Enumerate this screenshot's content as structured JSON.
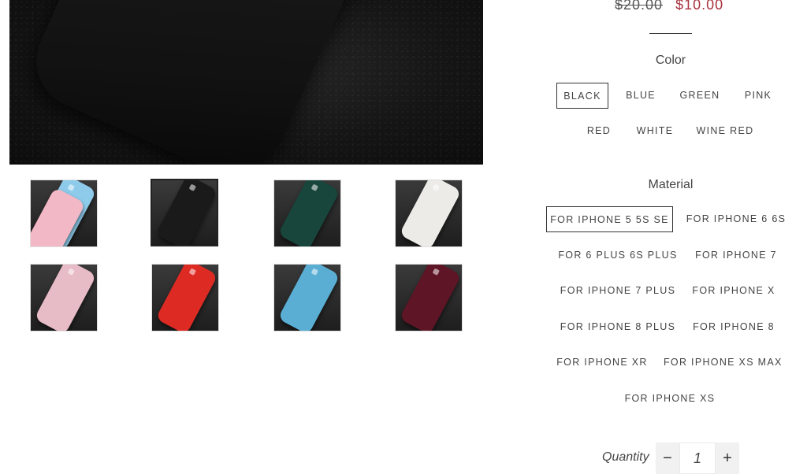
{
  "product": {
    "old_price": "$20.00",
    "new_price": "$10.00"
  },
  "thumbnails": [
    {
      "name": "blue-pink",
      "colors": [
        "#8ecbea",
        "#f3b8c6"
      ]
    },
    {
      "name": "black",
      "colors": [
        "#1a1a1a"
      ]
    },
    {
      "name": "green",
      "colors": [
        "#18463c"
      ]
    },
    {
      "name": "white",
      "colors": [
        "#ecebe8"
      ]
    },
    {
      "name": "pink",
      "colors": [
        "#e7bcc6"
      ]
    },
    {
      "name": "red",
      "colors": [
        "#dd2b24"
      ]
    },
    {
      "name": "sky-blue",
      "colors": [
        "#5aaed4"
      ]
    },
    {
      "name": "wine-red",
      "colors": [
        "#5e1526"
      ]
    }
  ],
  "color_section": {
    "title": "Color",
    "options": [
      "Black",
      "Blue",
      "Green",
      "Pink",
      "Red",
      "White",
      "Wine Red"
    ],
    "selected": "Black"
  },
  "material_section": {
    "title": "Material",
    "options": [
      "For iPhone 5 5S SE",
      "For iPhone 6 6S",
      "For 6 Plus 6S Plus",
      "For iPhone 7",
      "For iPhone 7 Plus",
      "For iPhone X",
      "For iPhone 8 Plus",
      "For iPhone 8",
      "For iPhone XR",
      "For iPhone XS Max",
      "For iPhone XS"
    ],
    "selected": "For iPhone 5 5S SE"
  },
  "quantity": {
    "label": "Quantity",
    "value": "1",
    "minus": "−",
    "plus": "+"
  }
}
